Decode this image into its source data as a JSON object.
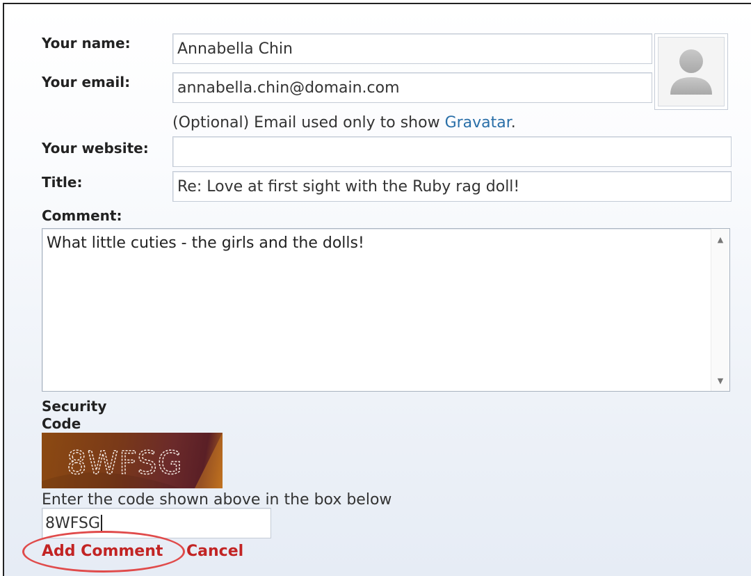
{
  "form": {
    "name_label": "Your name:",
    "name_value": "Annabella Chin",
    "email_label": "Your email:",
    "email_value": "annabella.chin@domain.com",
    "email_hint_prefix": "(Optional) Email used only to show ",
    "email_hint_link": "Gravatar",
    "email_hint_suffix": ".",
    "website_label": "Your website:",
    "website_value": "",
    "title_label": "Title:",
    "title_value": "Re: Love at first sight with the Ruby rag doll!",
    "comment_label": "Comment:",
    "comment_value": "What little cuties - the girls and the dolls!",
    "security_label_line1": "Security",
    "security_label_line2": "Code",
    "captcha_text": "8WFSG",
    "captcha_instructions": "Enter the code shown above in the box below",
    "captcha_value": "8WFSG",
    "add_comment_label": "Add Comment",
    "cancel_label": "Cancel"
  },
  "icons": {
    "avatar": "default-avatar-icon",
    "scroll_up": "scroll-up-arrow-icon",
    "scroll_down": "scroll-down-arrow-icon"
  },
  "colors": {
    "action_link": "#c22424",
    "hint_link": "#2a6fa8",
    "highlight": "#e04b4b"
  }
}
